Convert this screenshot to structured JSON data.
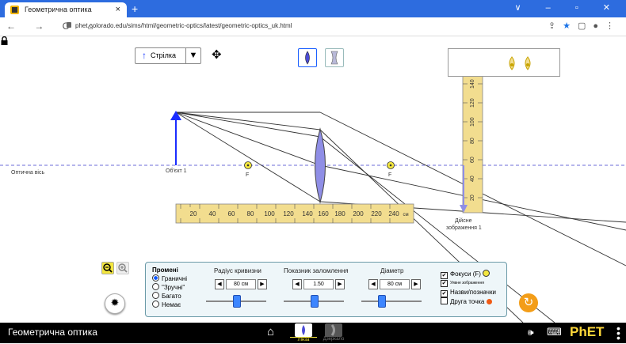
{
  "browser": {
    "tab_title": "Геометрична оптика",
    "tab_close": "×",
    "new_tab": "+",
    "url": "phet.colorado.edu/sims/html/geometric-optics/latest/geometric-optics_uk.html",
    "nav_icons": "← → C ⌂",
    "right_icons": [
      "share-icon",
      "star-icon",
      "sidebar-icon",
      "profile-icon",
      "menu-icon"
    ],
    "window_controls": "∨ – ▫ ✕"
  },
  "sim": {
    "arrow_object_label": "Стрілка",
    "optical_axis_label": "Оптична вісь",
    "object_label": "Об'єкт 1",
    "focal_left": "F",
    "focal_right": "F",
    "image_label_line1": "Дійсне",
    "image_label_line2": "зображення 1",
    "ruler_horizontal_ticks": [
      "20",
      "40",
      "60",
      "80",
      "100",
      "120",
      "140",
      "160",
      "180",
      "200",
      "220",
      "240"
    ],
    "ruler_horizontal_unit": "см",
    "ruler_vertical_ticks": [
      "140",
      "120",
      "100",
      "80",
      "60",
      "40",
      "20"
    ]
  },
  "panel": {
    "rays_title": "Промені",
    "rays_options": [
      "Граничні",
      "\"Зручні\"",
      "Багато",
      "Немає"
    ],
    "rays_selected": "Граничні",
    "radius_title": "Радіус кривизни",
    "radius_value": "80 см",
    "index_title": "Показник заломлення",
    "index_value": "1.50",
    "diameter_title": "Діаметр",
    "diameter_value": "80 см",
    "checkboxes": [
      {
        "label": "Фокуси (F)",
        "checked": true
      },
      {
        "label": "Уявне зображення",
        "checked": true
      },
      {
        "label": "Назви/позначки",
        "checked": true
      },
      {
        "label": "Друга точка",
        "checked": false
      }
    ],
    "slider_levels": {
      "radius": 0.5,
      "index": 0.5,
      "diameter": 0.35
    }
  },
  "navbar": {
    "title": "Геометрична оптика",
    "screens": [
      "Лінза",
      "Дзеркало"
    ],
    "logo": "PhET"
  },
  "colors": {
    "chrome_blue": "#2d6cdf",
    "object_arrow": "#1a2cff",
    "lens_fill": "#8f8ee6",
    "ruler_yellow": "#f2dd8f",
    "focal_yellow": "#f3e63f",
    "panel_bg": "#eef6f9",
    "reset_orange": "#f39d18",
    "second_point": "#f05a14"
  }
}
